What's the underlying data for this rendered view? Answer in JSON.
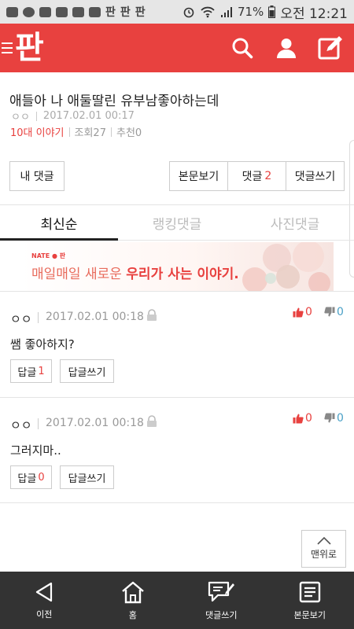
{
  "status_bar": {
    "battery": "71%",
    "time": "오전 12:21",
    "apps": [
      "판",
      "판",
      "판"
    ]
  },
  "header": {
    "logo_text": "판",
    "accent_color": "#e8413f",
    "icons": [
      "search-icon",
      "user-icon",
      "write-icon"
    ]
  },
  "article": {
    "title": "애들아 나 애둘딸린 유부남좋아하는데",
    "author": "ㅇㅇ",
    "date": "2017.02.01 00:17",
    "category": "10대 이야기",
    "views": "조회27",
    "recommend": "추천0"
  },
  "actions": {
    "my_comments": "내 댓글",
    "view_post": "본문보기",
    "comments_label": "댓글",
    "comments_count": "2",
    "write_comment": "댓글쓰기"
  },
  "tabs": [
    "최신순",
    "랭킹댓글",
    "사진댓글"
  ],
  "banner": {
    "brand": "NATE ● 판",
    "text_plain": "매일매일 새로운 ",
    "text_highlight": "우리가 사는 이야기."
  },
  "comments": [
    {
      "author": "ㅇㅇ",
      "date": "2017.02.01 00:18",
      "likes": "0",
      "dislikes": "0",
      "body": "쌤 좋아하지?",
      "reply_label": "답글",
      "reply_count": "1",
      "write_reply": "답글쓰기"
    },
    {
      "author": "ㅇㅇ",
      "date": "2017.02.01 00:18",
      "likes": "0",
      "dislikes": "0",
      "body": "그러지마..",
      "reply_label": "답글",
      "reply_count": "0",
      "write_reply": "답글쓰기"
    }
  ],
  "top_button": "맨위로",
  "bottom_nav": [
    {
      "label": "이전",
      "icon": "back-icon"
    },
    {
      "label": "홈",
      "icon": "home-icon"
    },
    {
      "label": "댓글쓰기",
      "icon": "comment-write-icon"
    },
    {
      "label": "본문보기",
      "icon": "document-icon"
    }
  ]
}
